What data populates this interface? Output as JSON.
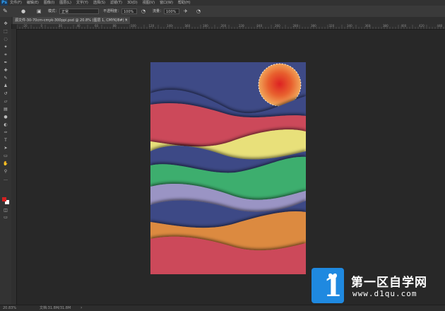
{
  "menubar": {
    "logo": "Ps",
    "items": [
      "文件(F)",
      "编辑(E)",
      "图像(I)",
      "图层(L)",
      "文字(Y)",
      "选择(S)",
      "滤镜(T)",
      "3D(D)",
      "视图(V)",
      "窗口(W)",
      "帮助(H)"
    ]
  },
  "options": {
    "mode_label": "模式：",
    "mode_value": "正常",
    "opacity_label": "不透明度：",
    "opacity_value": "100%",
    "flow_label": "流量：",
    "flow_value": "100%"
  },
  "document_tab": {
    "title": "源文件-30-70cm-cmyk-300ppi.psd @ 20.8% (图层 1, CMYK/8#) *",
    "close": "×"
  },
  "ruler_ticks": [
    "-20",
    "0",
    "20",
    "40",
    "60",
    "80",
    "100",
    "120",
    "140",
    "160",
    "180",
    "200",
    "220",
    "240",
    "260",
    "280",
    "300",
    "320",
    "340",
    "360",
    "380",
    "400",
    "420",
    "440"
  ],
  "toolbar": {
    "icons": [
      "move-icon",
      "marquee-icon",
      "lasso-icon",
      "quick-select-icon",
      "crop-icon",
      "eyedropper-icon",
      "healing-brush-icon",
      "brush-icon",
      "stamp-icon",
      "history-brush-icon",
      "eraser-icon",
      "gradient-icon",
      "blur-icon",
      "dodge-icon",
      "pen-icon",
      "type-icon",
      "path-select-icon",
      "shape-icon",
      "hand-icon",
      "zoom-icon",
      "more-tools-icon"
    ],
    "foreground_color": "#d42020",
    "background_color": "#ffffff"
  },
  "artwork": {
    "colors": {
      "navy": "#3e4a86",
      "red": "#cc4a5a",
      "yellow": "#e8e07a",
      "green": "#3dae6e",
      "lavender": "#9a94c4",
      "orange": "#dc8a40",
      "sun_center": "#dd2222",
      "sun_edge": "#f1a65a"
    }
  },
  "status": {
    "zoom": "20.83%",
    "doc": "文档:31.8M/31.8M"
  },
  "watermark": {
    "title": "第一区自学网",
    "url": "www.d1qu.com"
  }
}
